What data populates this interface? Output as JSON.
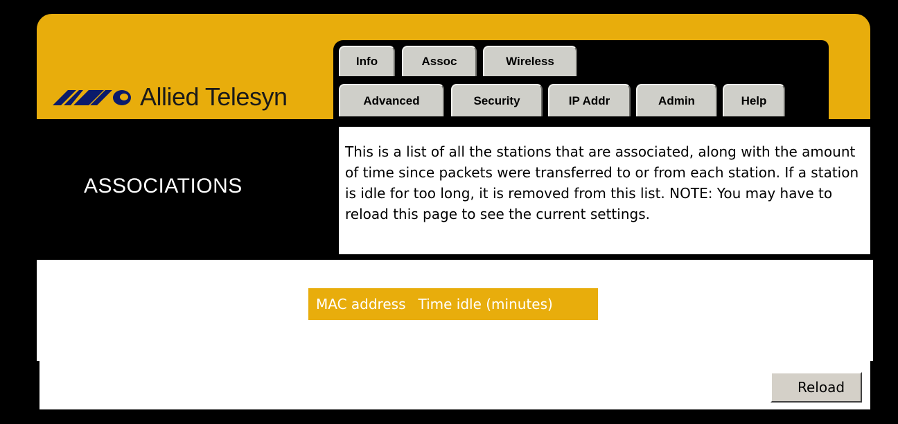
{
  "brand": {
    "name": "Allied Telesyn"
  },
  "tabs": {
    "row1": [
      {
        "label": "Info"
      },
      {
        "label": "Assoc"
      },
      {
        "label": "Wireless"
      }
    ],
    "row2": [
      {
        "label": "Advanced"
      },
      {
        "label": "Security"
      },
      {
        "label": "IP Addr"
      },
      {
        "label": "Admin"
      },
      {
        "label": "Help"
      }
    ]
  },
  "page": {
    "title": "ASSOCIATIONS",
    "description": "This is a list of all the stations that are associated, along with the amount of time since packets were transferred to or from each station. If a station is idle for too long, it is removed from this list. NOTE: You may have to reload this page to see the current settings."
  },
  "table": {
    "columns": [
      "MAC address",
      "Time idle (minutes)"
    ],
    "rows": []
  },
  "actions": {
    "reload_label": "Reload"
  },
  "colors": {
    "accent": "#e8ad0c",
    "background": "#000000",
    "panel": "#ffffff",
    "tab": "#cfcfc9",
    "button": "#d4d0c8"
  }
}
